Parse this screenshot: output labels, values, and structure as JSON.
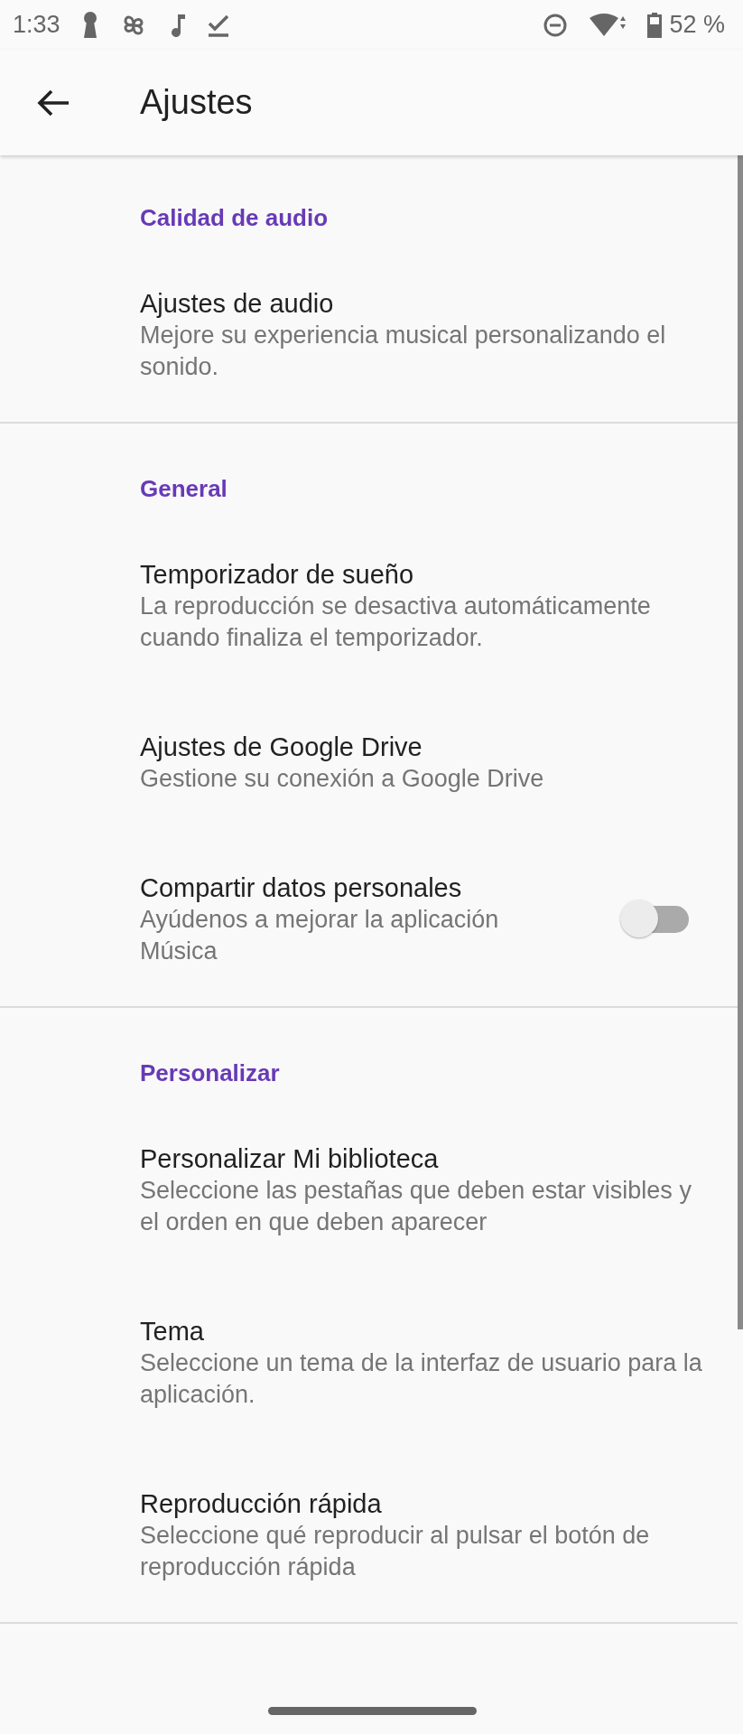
{
  "status_bar": {
    "time": "1:33",
    "battery": "52 %"
  },
  "app_bar": {
    "title": "Ajustes"
  },
  "sections": [
    {
      "header": "Calidad de audio",
      "items": [
        {
          "kind": "link",
          "title": "Ajustes de audio",
          "subtitle": "Mejore su experiencia musical personalizando el sonido."
        }
      ]
    },
    {
      "header": "General",
      "items": [
        {
          "kind": "link",
          "title": "Temporizador de sueño",
          "subtitle": "La reproducción se desactiva automáticamente cuando finaliza el temporizador."
        },
        {
          "kind": "link",
          "title": "Ajustes de Google Drive",
          "subtitle": "Gestione su conexión a Google Drive"
        },
        {
          "kind": "switch",
          "title": "Compartir datos personales",
          "subtitle": "Ayúdenos a mejorar la aplicación Música",
          "on": false
        }
      ]
    },
    {
      "header": "Personalizar",
      "items": [
        {
          "kind": "link",
          "title": "Personalizar Mi biblioteca",
          "subtitle": "Seleccione las pestañas que deben estar visibles y el orden en que deben aparecer"
        },
        {
          "kind": "link",
          "title": "Tema",
          "subtitle": "Seleccione un tema de la interfaz de usuario para la aplicación."
        },
        {
          "kind": "link",
          "title": "Reproducción rápida",
          "subtitle": "Seleccione qué reproducir al pulsar el botón de reproducción rápida"
        }
      ]
    }
  ]
}
